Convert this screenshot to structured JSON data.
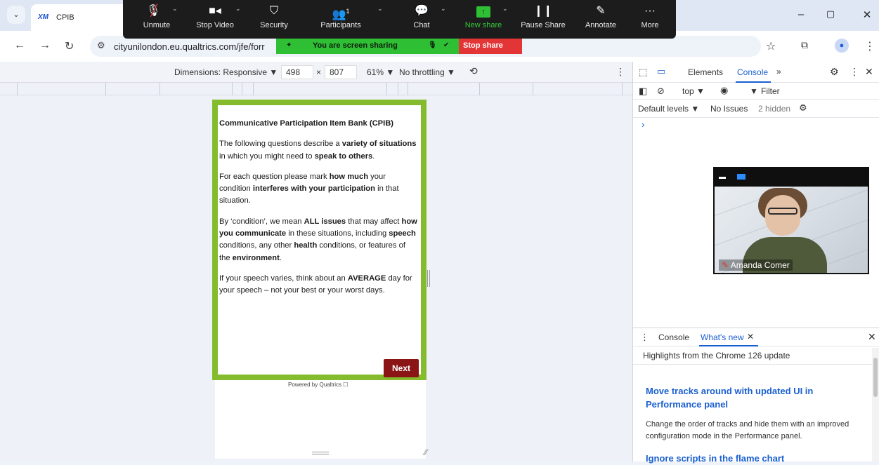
{
  "browser": {
    "tab_title": "CPIB",
    "tab_favicon": "XM",
    "url": "cityunilondon.eu.qualtrics.com/jfe/forr",
    "window_controls": {
      "minimize": "–",
      "maximize": "▢",
      "close": "✕"
    }
  },
  "zoom": {
    "items": [
      {
        "label": "Unmute",
        "icon": "mic-muted-icon"
      },
      {
        "label": "Stop Video",
        "icon": "video-icon"
      },
      {
        "label": "Security",
        "icon": "shield-icon"
      },
      {
        "label": "Participants",
        "icon": "participants-icon",
        "count": "1"
      },
      {
        "label": "Chat",
        "icon": "chat-icon"
      },
      {
        "label": "New share",
        "icon": "share-icon"
      },
      {
        "label": "Pause Share",
        "icon": "pause-icon"
      },
      {
        "label": "Annotate",
        "icon": "pen-icon"
      },
      {
        "label": "More",
        "icon": "more-icon"
      }
    ],
    "sharing_text": "You are screen sharing",
    "stop_share": "Stop share"
  },
  "device_toolbar": {
    "dimensions_label": "Dimensions: Responsive ▼",
    "width": "498",
    "times": "×",
    "height": "807",
    "zoom": "61% ▼",
    "throttling": "No throttling ▼"
  },
  "survey": {
    "title": "Communicative Participation Item Bank (CPIB)",
    "p1_a": "The following questions describe a ",
    "p1_b": "variety of situations",
    "p1_c": " in which you might need to ",
    "p1_d": "speak to others",
    "p1_e": ".",
    "p2_a": "For each question please mark ",
    "p2_b": "how much",
    "p2_c": " your condition ",
    "p2_d": "interferes with your participation",
    "p2_e": " in that situation.",
    "p3_a": "By ‘condition’, we mean ",
    "p3_b": "ALL issues",
    "p3_c": " that may affect ",
    "p3_d": "how you communicate",
    "p3_e": " in these situations, including ",
    "p3_f": "speech",
    "p3_g": " conditions, any other ",
    "p3_h": "health",
    "p3_i": " conditions, or features of the ",
    "p3_j": "environment",
    "p3_k": ".",
    "p4_a": "If your speech varies, think about an ",
    "p4_b": "AVERAGE",
    "p4_c": " day for your speech – not your best or your worst days.",
    "next_label": "Next",
    "powered_by": "Powered by Qualtrics ☐"
  },
  "devtools": {
    "tabs": {
      "elements": "Elements",
      "console": "Console",
      "more": "»"
    },
    "context": "top ▼",
    "filter": "Filter",
    "levels": "Default levels ▼",
    "issues": "No Issues",
    "hidden": "2 hidden",
    "prompt": "›",
    "drawer_tabs": {
      "console": "Console",
      "whats_new": "What's new"
    },
    "highlights": "Highlights from the Chrome 126 update",
    "h1": "Move tracks around with updated UI in Performance panel",
    "b1": "Change the order of tracks and hide them with an improved configuration mode in the Performance panel.",
    "h2": "Ignore scripts in the flame chart"
  },
  "video": {
    "participant_name": "Amanda Comer"
  },
  "colors": {
    "survey_border": "#84bc2d",
    "next_button": "#8b1414",
    "share_green": "#2fbf35",
    "stop_red": "#e33535",
    "link": "#1a5fd0"
  }
}
